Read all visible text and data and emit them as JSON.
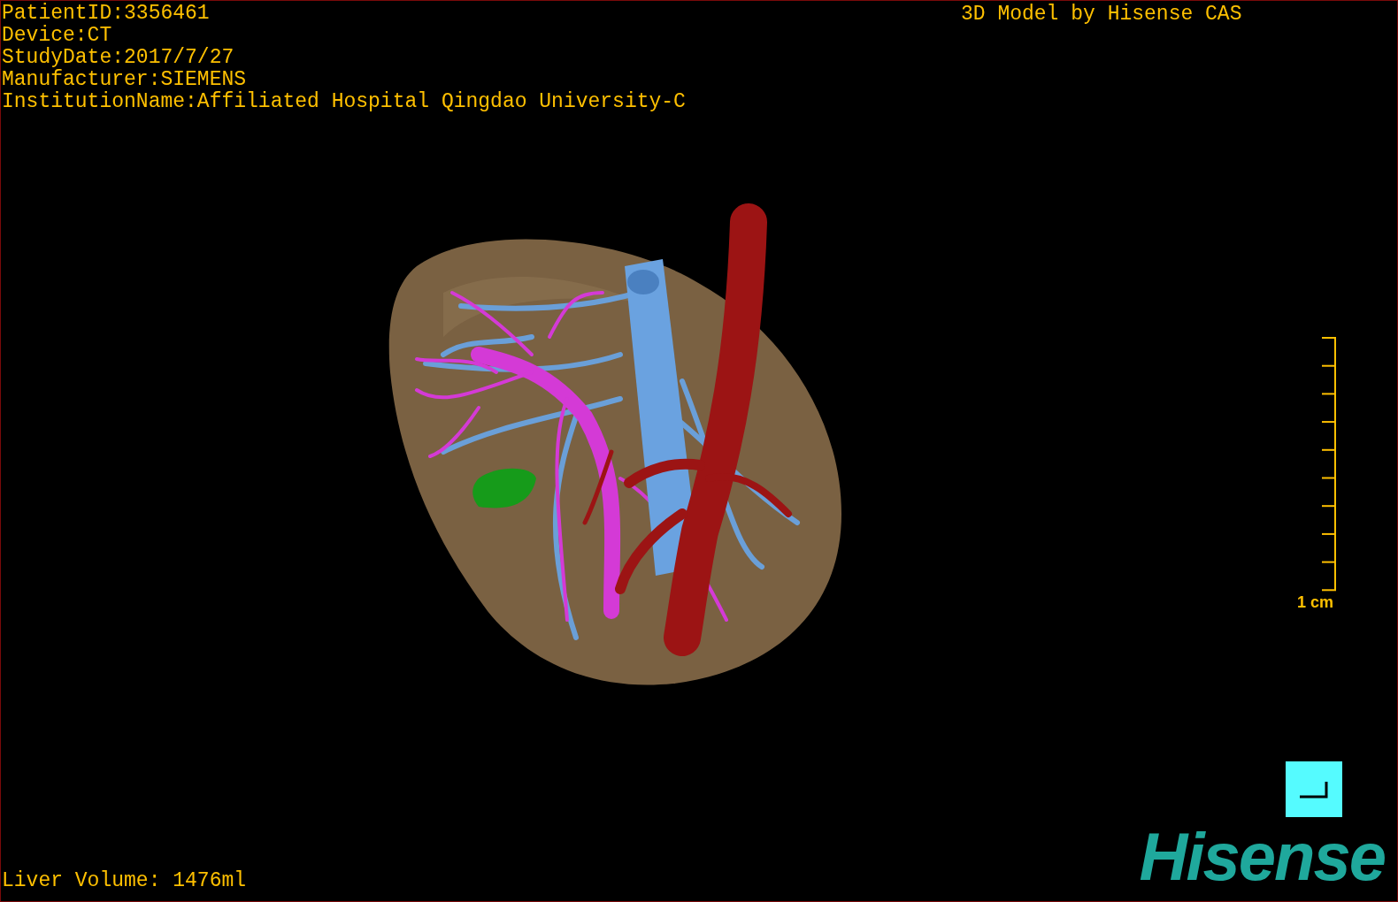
{
  "patient_info": [
    "PatientID:3356461",
    "Device:CT",
    "StudyDate:2017/7/27",
    "Manufacturer:SIEMENS",
    "InstitutionName:Affiliated Hospital Qingdao University-C"
  ],
  "caption": "3D Model by Hisense CAS",
  "scale_bar": {
    "label": "1 cm"
  },
  "liver_volume": "Liver Volume: 1476ml",
  "logo": "Hisense"
}
